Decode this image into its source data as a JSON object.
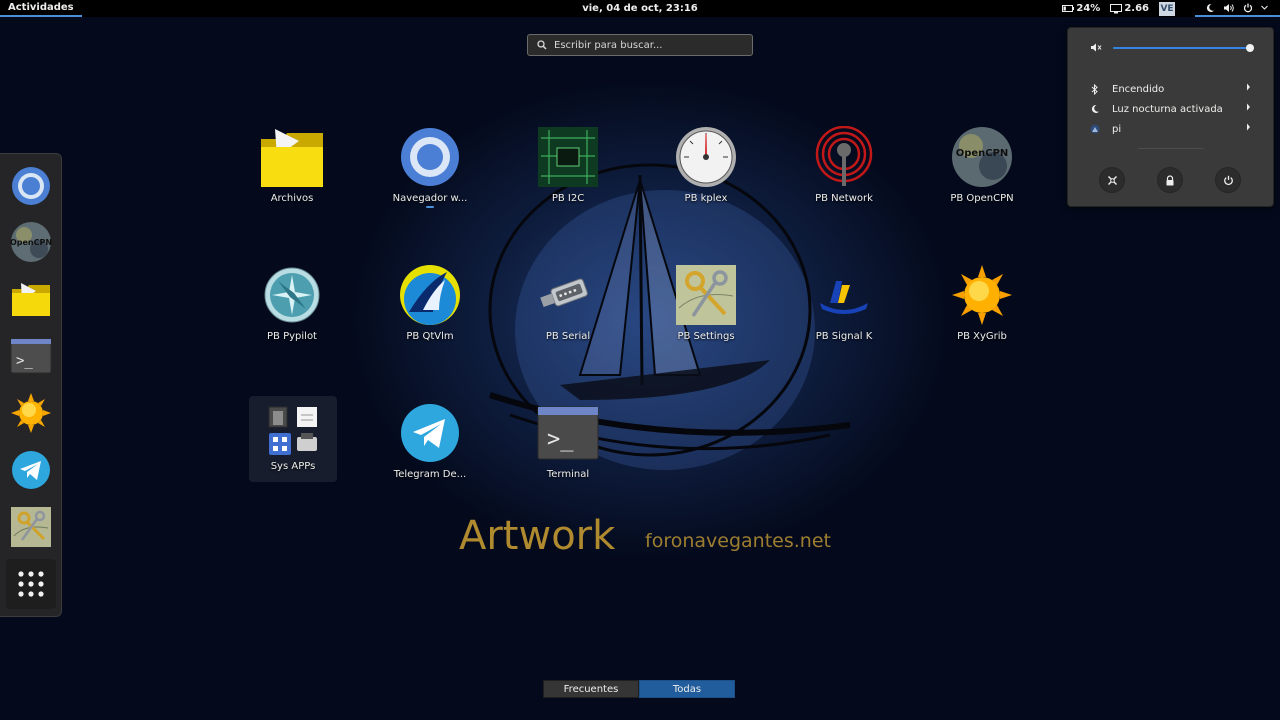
{
  "topbar": {
    "activities_label": "Actividades",
    "clock": "vie, 04 de oct, 23:16",
    "battery_text": "24%",
    "load_text": "2.66",
    "ve_label": "VE"
  },
  "search": {
    "placeholder": "Escribir para buscar..."
  },
  "artwork": {
    "title": "Artwork",
    "site": "foronavegantes.net"
  },
  "dash": {
    "items": [
      {
        "name": "chromium",
        "icon": "chromium-icon"
      },
      {
        "name": "opencpn",
        "icon": "opencpn-icon",
        "label": "OpenCPN"
      },
      {
        "name": "files",
        "icon": "folder-icon"
      },
      {
        "name": "terminal",
        "icon": "terminal-icon",
        "label": ">_"
      },
      {
        "name": "xygrib",
        "icon": "sun-icon"
      },
      {
        "name": "telegram",
        "icon": "telegram-icon"
      },
      {
        "name": "pb-settings",
        "icon": "settings-map-icon"
      }
    ],
    "show_apps_icon": "show-apps-grid-icon"
  },
  "apps": [
    {
      "label": "Archivos",
      "icon": "folder-icon"
    },
    {
      "label": "Navegador w...",
      "icon": "chromium-icon",
      "running": true
    },
    {
      "label": "PB I2C",
      "icon": "circuit-board-icon"
    },
    {
      "label": "PB kplex",
      "icon": "gauge-icon"
    },
    {
      "label": "PB Network",
      "icon": "antenna-icon"
    },
    {
      "label": "PB OpenCPN",
      "icon": "opencpn-icon",
      "icon_text": "OpenCPN"
    },
    {
      "label": "PB Pypilot",
      "icon": "compass-rose-icon"
    },
    {
      "label": "PB QtVlm",
      "icon": "sail-icon"
    },
    {
      "label": "PB Serial",
      "icon": "serial-connector-icon"
    },
    {
      "label": "PB Settings",
      "icon": "keys-on-map-icon"
    },
    {
      "label": "PB Signal K",
      "icon": "signalk-icon"
    },
    {
      "label": "PB XyGrib",
      "icon": "sun-icon"
    },
    {
      "label": "Sys APPs",
      "icon": "app-folder-icon",
      "focused": true
    },
    {
      "label": "Telegram De...",
      "icon": "telegram-icon"
    },
    {
      "label": "Terminal",
      "icon": "terminal-icon",
      "icon_text": ">_"
    }
  ],
  "view_toggle": {
    "frequent_label": "Frecuentes",
    "all_label": "Todas",
    "active": "all"
  },
  "system_menu": {
    "volume_level": 1.0,
    "volume_icon": "speaker-muted-icon",
    "items": [
      {
        "label": "Encendido",
        "icon": "bluetooth-icon"
      },
      {
        "label": "Luz nocturna activada",
        "icon": "night-light-icon"
      },
      {
        "label": "pi",
        "icon": "user-avatar-icon"
      }
    ],
    "buttons": [
      "settings-icon",
      "lock-icon",
      "power-icon"
    ]
  },
  "colors": {
    "accent": "#4a90d9",
    "toggle_active": "#215d9c",
    "artwork_gold": "#b08a2e",
    "background": "#040a1c"
  }
}
